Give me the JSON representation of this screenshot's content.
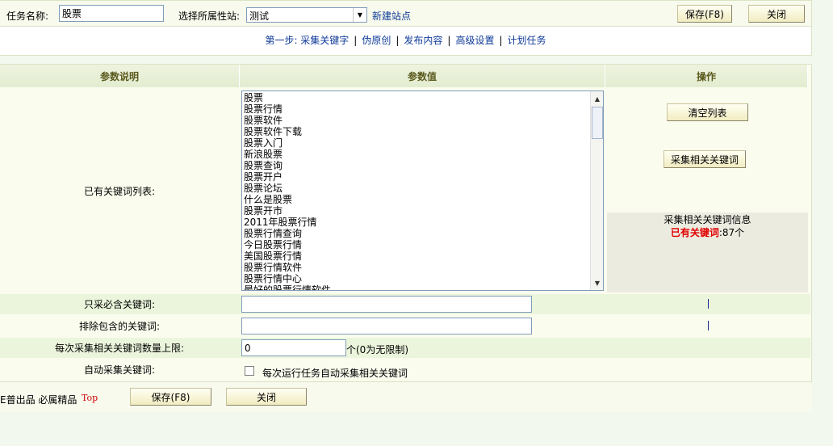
{
  "header": {
    "task_name_label": "任务名称:",
    "task_name_value": "股票",
    "site_label": "选择所属性站:",
    "site_selected": "测试",
    "new_site_link": "新建站点",
    "save_label": "保存(F8)",
    "close_label": "关闭"
  },
  "steps": [
    "第一步: 采集关键字",
    "伪原创",
    "发布内容",
    "高级设置",
    "计划任务"
  ],
  "table": {
    "col_desc": "参数说明",
    "col_value": "参数值",
    "col_action": "操作",
    "keyword_list_label": "已有关键词列表:",
    "keywords": [
      "股票",
      "股票行情",
      "股票软件",
      "股票软件下载",
      "股票入门",
      "新浪股票",
      "股票查询",
      "股票开户",
      "股票论坛",
      "什么是股票",
      "股票开市",
      "2011年股票行情",
      "股票行情查询",
      "今日股票行情",
      "美国股票行情",
      "股票行情软件",
      "股票行情中心",
      "最好的股票行情软件"
    ],
    "clear_list_label": "清空列表",
    "collect_related_label": "采集相关关键词",
    "info_title": "采集相关关键词信息",
    "info_count_label": "已有关键词",
    "info_count_value": ":87个",
    "must_contain_label": "只采必含关键词:",
    "must_contain_value": "",
    "exclude_label": "排除包含的关键词:",
    "exclude_value": "",
    "limit_label": "每次采集相关关键词数量上限:",
    "limit_value": "0",
    "limit_hint": "个(0为无限制)",
    "auto_label": "自动采集关键词:",
    "auto_checkbox_label": "每次运行任务自动采集相关关键词"
  },
  "footer": {
    "brand_text": "E普出品 必属精品",
    "top_link": "Top",
    "save_label": "保存(F8)",
    "close_label": "关闭"
  }
}
